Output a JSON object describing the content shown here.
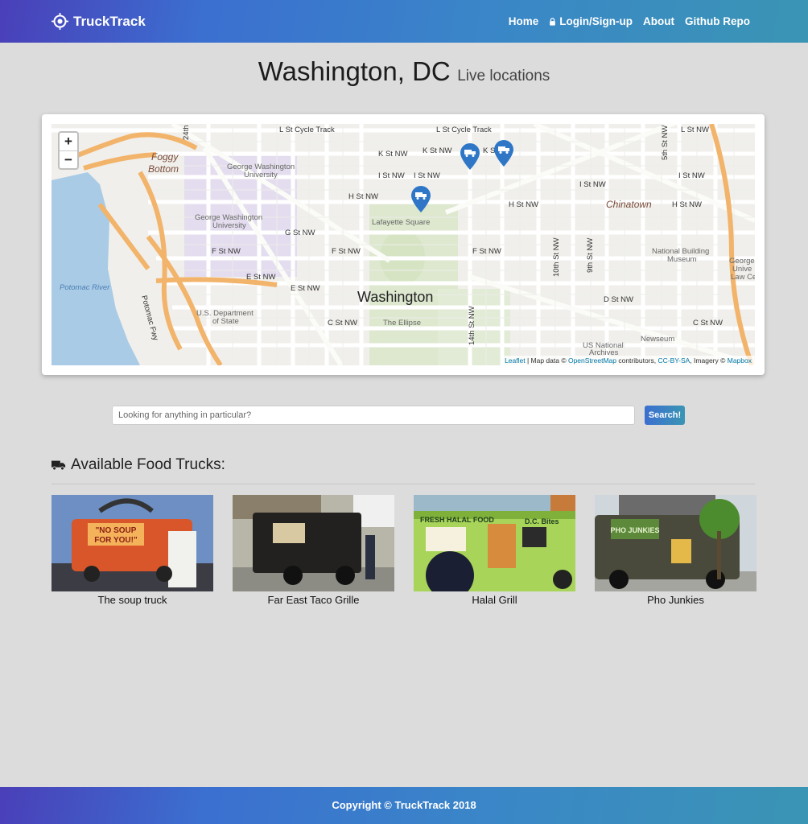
{
  "nav": {
    "brand": "TruckTrack",
    "links": [
      {
        "label": "Home",
        "icon": ""
      },
      {
        "label": "Login/Sign-up",
        "icon": "lock-icon"
      },
      {
        "label": "About",
        "icon": ""
      },
      {
        "label": "Github Repo",
        "icon": ""
      }
    ]
  },
  "heading": {
    "city": "Washington, DC",
    "subtitle": "Live locations"
  },
  "map": {
    "zoom_in": "+",
    "zoom_out": "−",
    "attribution": {
      "leaflet": "Leaflet",
      "sep1": " | Map data © ",
      "osm": "OpenStreetMap",
      "mid": " contributors, ",
      "license": "CC-BY-SA",
      "imagery": ", Imagery © ",
      "mapbox": "Mapbox"
    },
    "labels": {
      "l_st_1": "L St Cycle Track",
      "l_st_2": "L St Cycle Track",
      "l_st_nw": "L St NW",
      "k_st_1": "K St NW",
      "k_st_2": "K St NW",
      "k_st_3": "K St",
      "i_st_1": "I St NW",
      "i_st_2": "I St NW",
      "i_st_3": "I St NW",
      "i_st_4": "I St NW",
      "h_st_1": "H St NW",
      "h_st_2": "H St NW",
      "h_st_3": "H St NW",
      "g_st": "G St NW",
      "f_st_1": "F St NW",
      "f_st_2": "F St NW",
      "f_st_3": "F St NW",
      "e_st_1": "E St NW",
      "e_st_2": "E St NW",
      "d_st": "D St NW",
      "c_st_1": "C St NW",
      "c_st_2": "C St NW",
      "foggy": "Foggy",
      "bottom": "Bottom",
      "gwu1": "George Washington",
      "gwu1b": "University",
      "gwu2": "George Washington",
      "gwu2b": "University",
      "lafayette": "Lafayette Square",
      "washington": "Washington",
      "ellipse": "The Ellipse",
      "chinatown": "Chinatown",
      "nbm1": "National Building",
      "nbm2": "Museum",
      "potomac": "Potomac River",
      "potomacfwy": "Potomac Fwy",
      "state1": "U.S. Department",
      "state2": "of State",
      "archives1": "US National",
      "archives2": "Archives",
      "newseum": "Newseum",
      "tenth": "10th St NW",
      "ninth": "9th St NW",
      "fifth": "5th St NW",
      "fourteenth": "14th St NW",
      "twentyfourth": "24th",
      "gl1": "George",
      "gl2": "Unive",
      "gl3": "Law Ce"
    },
    "marker_icon": "truck-marker-icon"
  },
  "search": {
    "placeholder": "Looking for anything in particular?",
    "button": "Search!"
  },
  "section": {
    "title": "Available Food Trucks:",
    "icon": "truck-icon"
  },
  "trucks": [
    {
      "name": "The soup truck"
    },
    {
      "name": "Far East Taco Grille"
    },
    {
      "name": "Halal Grill"
    },
    {
      "name": "Pho Junkies"
    }
  ],
  "photo_text": {
    "soup1": "\"NO SOUP",
    "soup2": "FOR YOU!\"",
    "halal1": "FRESH HALAL FOOD",
    "halal2": "D.C. Bites",
    "pho": "PHO JUNKIES"
  },
  "footer": {
    "text": "Copyright © TruckTrack 2018"
  }
}
